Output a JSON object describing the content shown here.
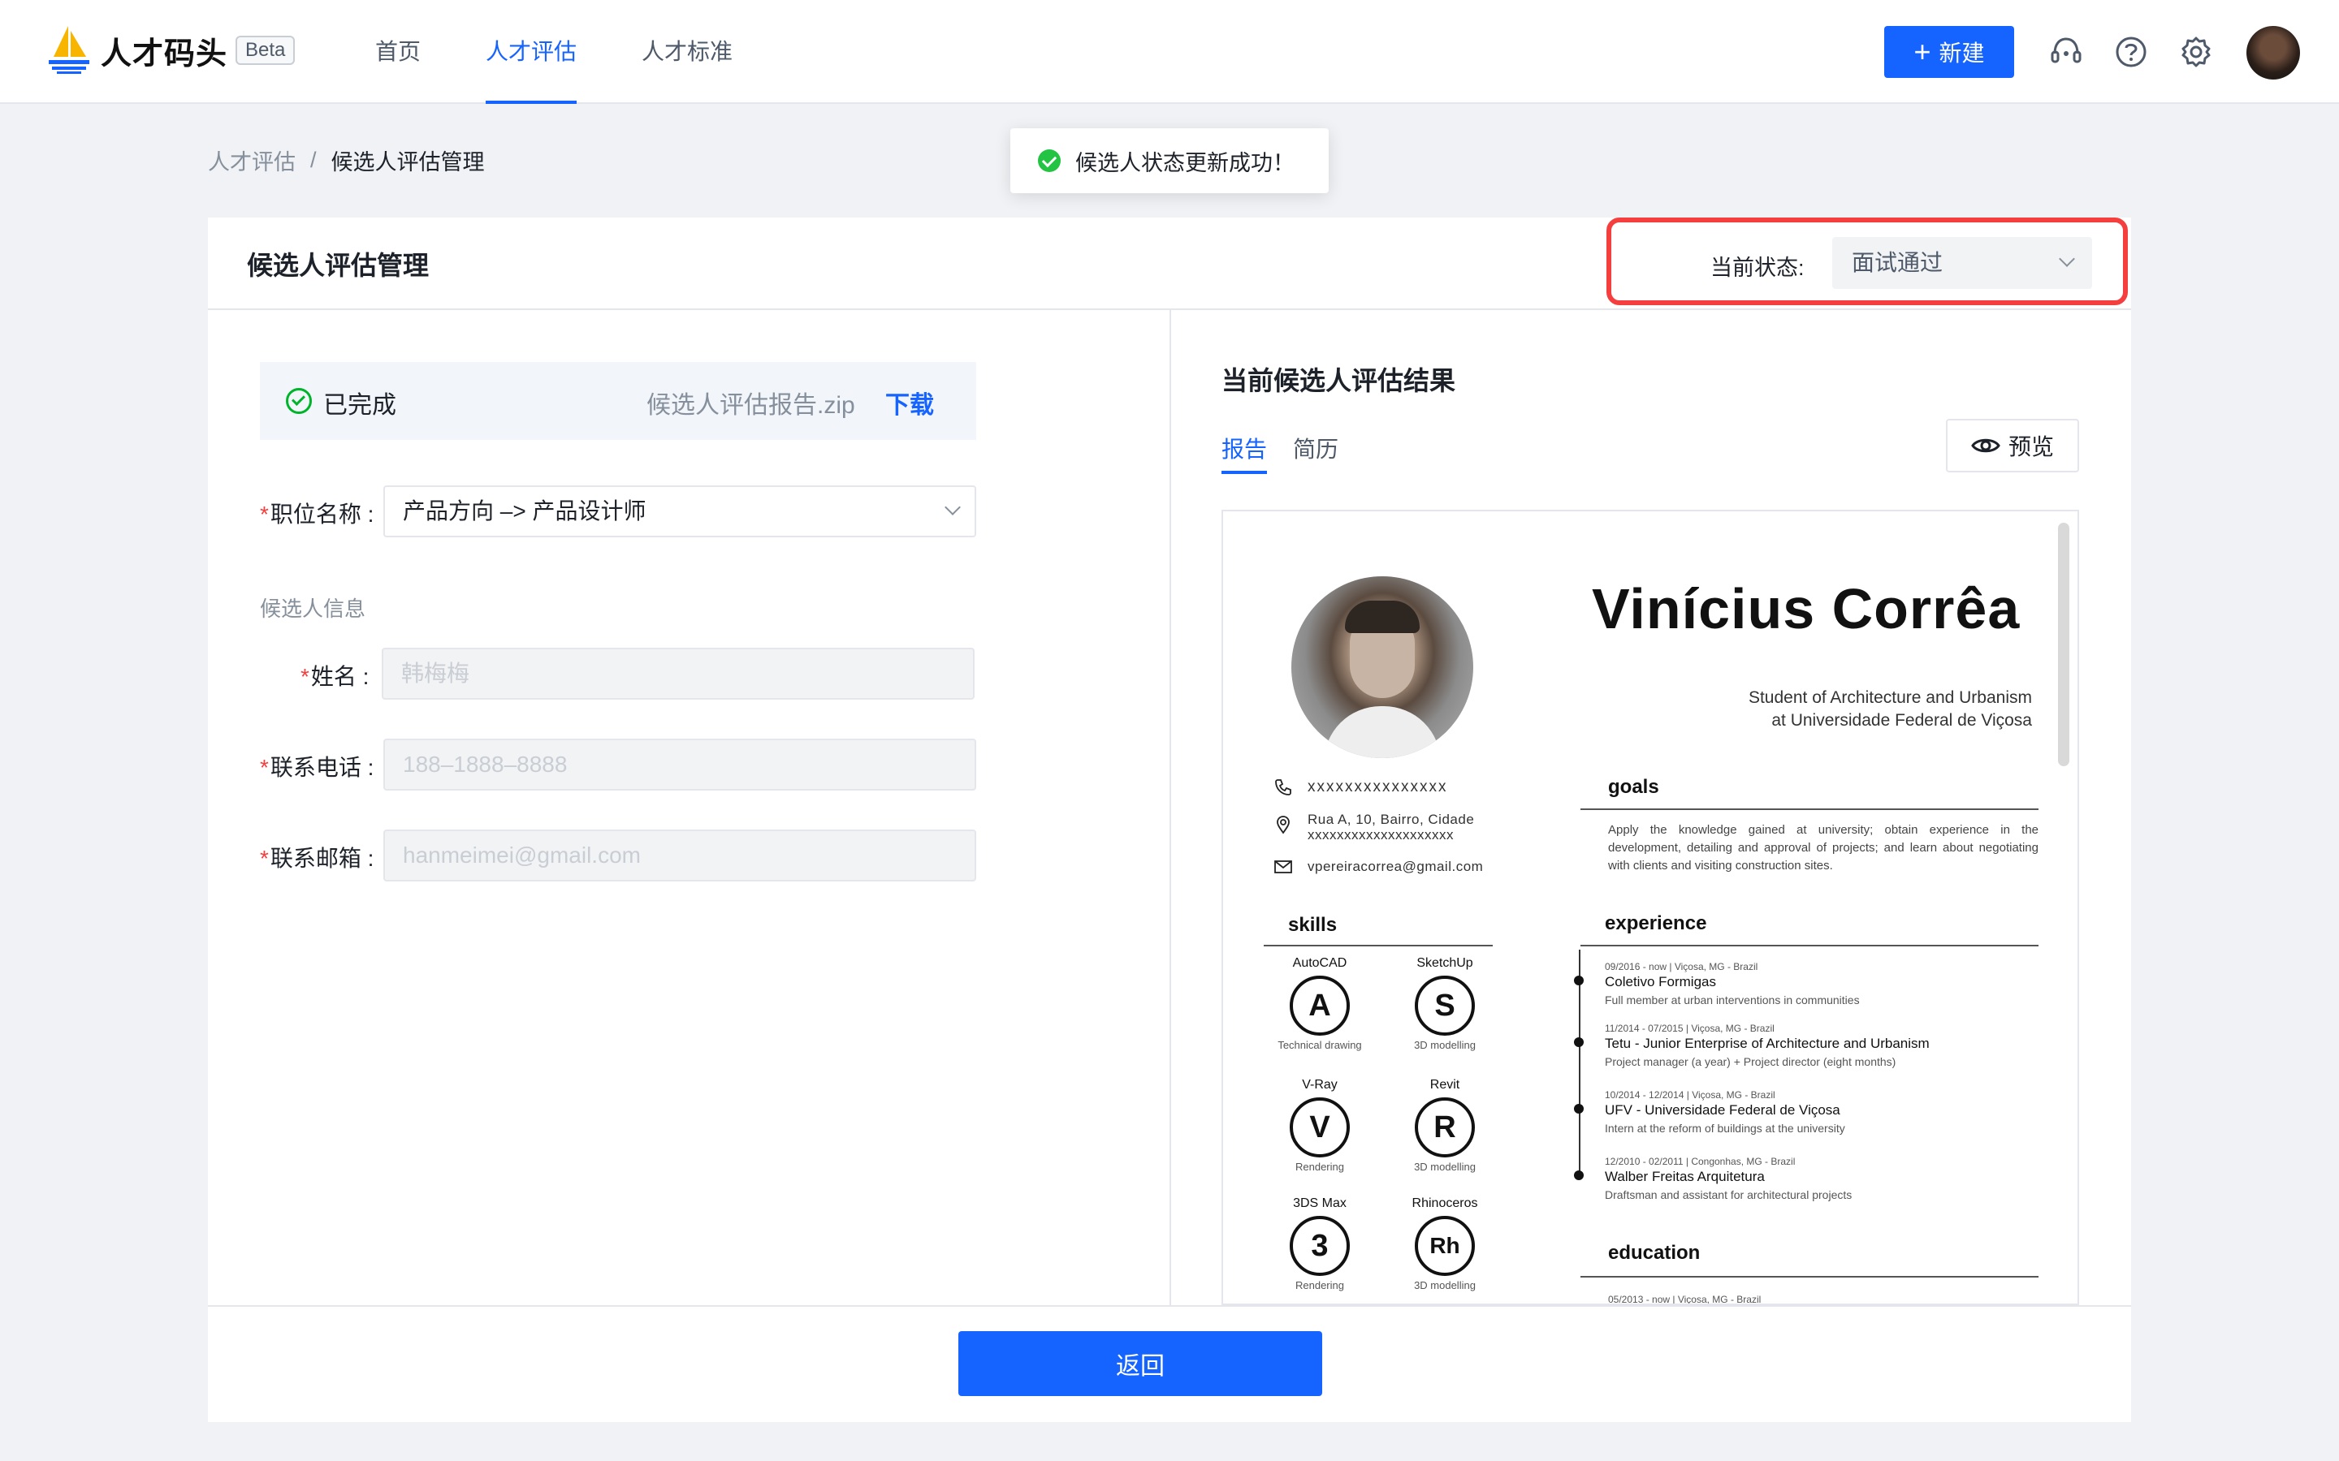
{
  "brand": {
    "name": "人才码头",
    "beta": "Beta"
  },
  "nav": [
    {
      "label": "首页",
      "active": false
    },
    {
      "label": "人才评估",
      "active": true
    },
    {
      "label": "人才标准",
      "active": false
    }
  ],
  "header_actions": {
    "new_label": "新建"
  },
  "breadcrumb": {
    "parent": "人才评估",
    "separator": "/",
    "current": "候选人评估管理"
  },
  "toast": {
    "message": "候选人状态更新成功！"
  },
  "card": {
    "title": "候选人评估管理",
    "status_label": "当前状态:",
    "status_value": "面试通过"
  },
  "left": {
    "report_status": "已完成",
    "report_file": "候选人评估报告.zip",
    "download_label": "下载",
    "position_label": "职位名称 :",
    "position_value": "产品方向 –> 产品设计师",
    "section_title": "候选人信息",
    "name_label": "姓名 :",
    "name_placeholder": "韩梅梅",
    "phone_label": "联系电话 :",
    "phone_placeholder": "188–1888–8888",
    "email_label": "联系邮箱 :",
    "email_placeholder": "hanmeimei@gmail.com",
    "required_mark": "*"
  },
  "right": {
    "title": "当前候选人评估结果",
    "tabs": [
      {
        "label": "报告",
        "active": true
      },
      {
        "label": "简历",
        "active": false
      }
    ],
    "preview_label": "预览"
  },
  "resume": {
    "name": "Vinícius Corrêa",
    "subtitle_line1": "Student of Architecture and Urbanism",
    "subtitle_line2": "at Universidade Federal de Viçosa",
    "phone": "xxxxxxxxxxxxxxx",
    "address_line1": "Rua A, 10, Bairro, Cidade",
    "address_line2": "xxxxxxxxxxxxxxxxxxxx",
    "email": "vpereiracorrea@gmail.com",
    "goals_title": "goals",
    "goals_text": "Apply the knowledge gained at university; obtain experience in the development, detailing and approval of projects; and learn about negotiating with clients and visiting construction sites.",
    "skills_title": "skills",
    "skills": [
      {
        "name": "AutoCAD",
        "glyph": "A",
        "desc": "Technical drawing"
      },
      {
        "name": "SketchUp",
        "glyph": "S",
        "desc": "3D modelling"
      },
      {
        "name": "V-Ray",
        "glyph": "V",
        "desc": "Rendering"
      },
      {
        "name": "Revit",
        "glyph": "R",
        "desc": "3D modelling"
      },
      {
        "name": "3DS Max",
        "glyph": "3",
        "desc": "Rendering"
      },
      {
        "name": "Rhinoceros",
        "glyph": "Rh",
        "desc": "3D modelling"
      }
    ],
    "experience_title": "experience",
    "experience": [
      {
        "meta": "09/2016 - now  |  Viçosa, MG - Brazil",
        "title": "Coletivo Formigas",
        "desc": "Full member at urban interventions in communities"
      },
      {
        "meta": "11/2014 - 07/2015  |  Viçosa, MG - Brazil",
        "title": "Tetu - Junior Enterprise of Architecture and Urbanism",
        "desc": "Project manager (a year) + Project director (eight months)"
      },
      {
        "meta": "10/2014 - 12/2014  |  Viçosa, MG - Brazil",
        "title": "UFV - Universidade Federal de Viçosa",
        "desc": "Intern at the reform of buildings at the university"
      },
      {
        "meta": "12/2010 - 02/2011  |  Congonhas, MG - Brazil",
        "title": "Walber Freitas Arquitetura",
        "desc": "Draftsman and assistant for architectural projects"
      }
    ],
    "education_title": "education",
    "education_meta": "05/2013 - now  |  Viçosa, MG - Brazil"
  },
  "footer": {
    "back_label": "返回"
  },
  "colors": {
    "primary": "#1664ff",
    "success": "#00b42a",
    "danger_outline": "#f53f3f"
  }
}
